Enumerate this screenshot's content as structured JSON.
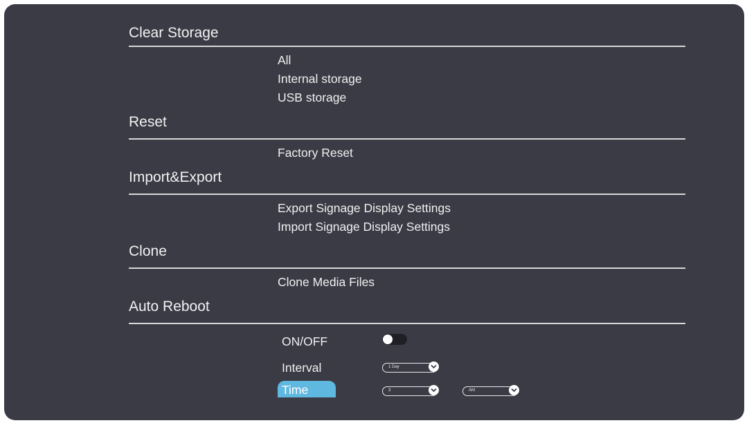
{
  "sections": {
    "clear_storage": {
      "title": "Clear Storage",
      "items": [
        "All",
        "Internal storage",
        "USB storage"
      ]
    },
    "reset": {
      "title": "Reset",
      "items": [
        "Factory Reset"
      ]
    },
    "import_export": {
      "title": "Import&Export",
      "items": [
        "Export Signage Display Settings",
        "Import Signage Display Settings"
      ]
    },
    "clone": {
      "title": "Clone",
      "items": [
        "Clone Media Files"
      ]
    },
    "auto_reboot": {
      "title": "Auto Reboot",
      "onoff_label": "ON/OFF",
      "onoff_state": "off",
      "interval_label": "Interval",
      "interval_value": "1 Day",
      "time_label": "Time",
      "time_hour_value": "3",
      "time_ampm_value": "AM"
    }
  },
  "colors": {
    "panel_bg": "#3b3b46",
    "highlight": "#5fb8df",
    "text": "#f0f0f0"
  }
}
